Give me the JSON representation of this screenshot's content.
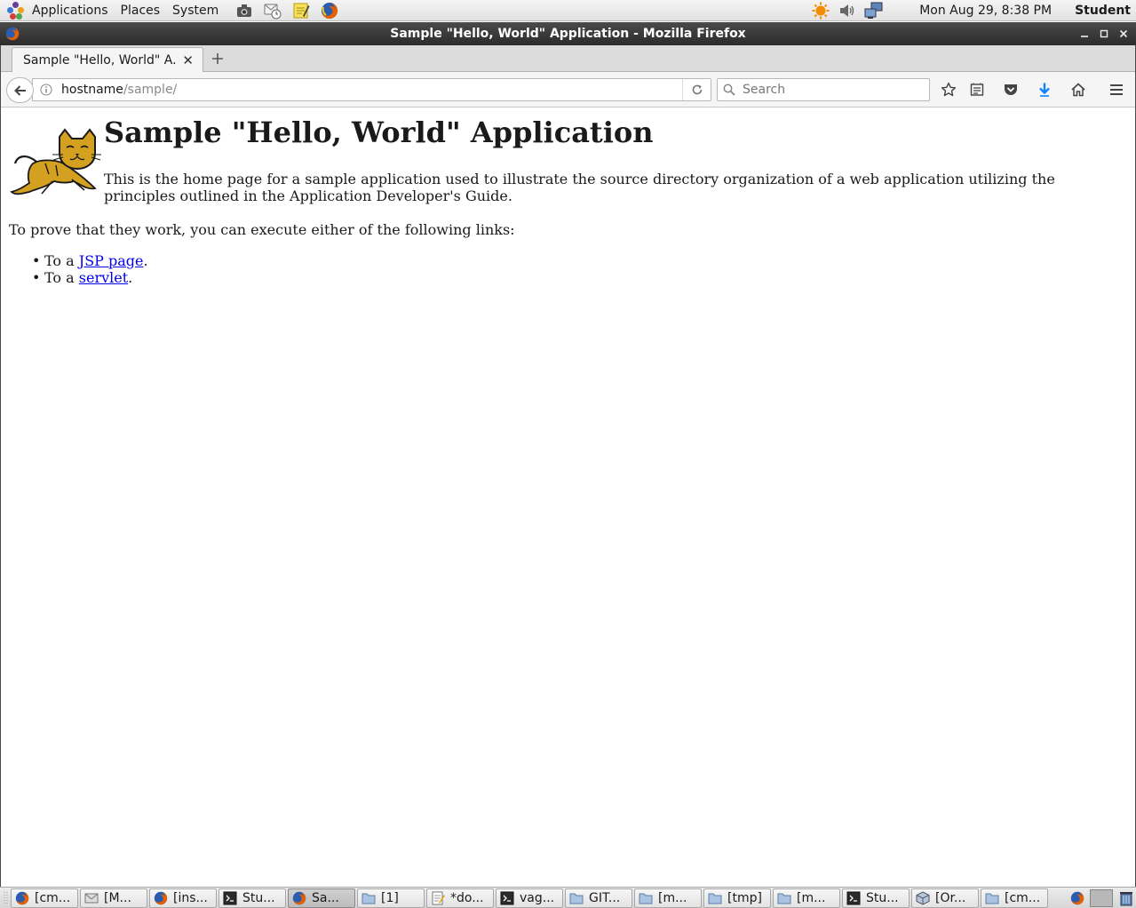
{
  "top_panel": {
    "menus": [
      "Applications",
      "Places",
      "System"
    ],
    "clock": "Mon Aug 29,  8:38 PM",
    "user": "Student"
  },
  "window": {
    "title": "Sample \"Hello, World\" Application - Mozilla Firefox"
  },
  "tabs": [
    {
      "title": "Sample \"Hello, World\" A..."
    }
  ],
  "nav": {
    "url_host": "hostname",
    "url_path": "/sample/",
    "search_placeholder": "Search"
  },
  "page": {
    "heading": "Sample \"Hello, World\" Application",
    "intro": "This is the home page for a sample application used to illustrate the source directory organization of a web application utilizing the principles outlined in the Application Developer's Guide.",
    "prove_text": "To prove that they work, you can execute either of the following links:",
    "links": [
      {
        "prefix": "To a ",
        "link_text": "JSP page",
        "suffix": "."
      },
      {
        "prefix": "To a ",
        "link_text": "servlet",
        "suffix": "."
      }
    ]
  },
  "taskbar": {
    "items": [
      {
        "label": "[cm...",
        "icon": "firefox-icon"
      },
      {
        "label": "[M...",
        "icon": "mail-icon"
      },
      {
        "label": "[ins...",
        "icon": "firefox-icon"
      },
      {
        "label": "Stu...",
        "icon": "terminal-icon"
      },
      {
        "label": "Sa...",
        "icon": "firefox-icon"
      },
      {
        "label": "[1]",
        "icon": "folder-icon"
      },
      {
        "label": "*do...",
        "icon": "text-editor-icon"
      },
      {
        "label": "vag...",
        "icon": "terminal-icon"
      },
      {
        "label": "GIT...",
        "icon": "folder-icon"
      },
      {
        "label": "[m...",
        "icon": "folder-icon"
      },
      {
        "label": "[tmp]",
        "icon": "folder-icon"
      },
      {
        "label": "[m...",
        "icon": "folder-icon"
      },
      {
        "label": "Stu...",
        "icon": "terminal-icon"
      },
      {
        "label": "[Or...",
        "icon": "virtualbox-icon"
      },
      {
        "label": "[cm...",
        "icon": "folder-icon"
      }
    ]
  },
  "colors": {
    "link": "#0000ee",
    "title_bar": "#2c2c2c",
    "download_arrow": "#0a84ff"
  }
}
